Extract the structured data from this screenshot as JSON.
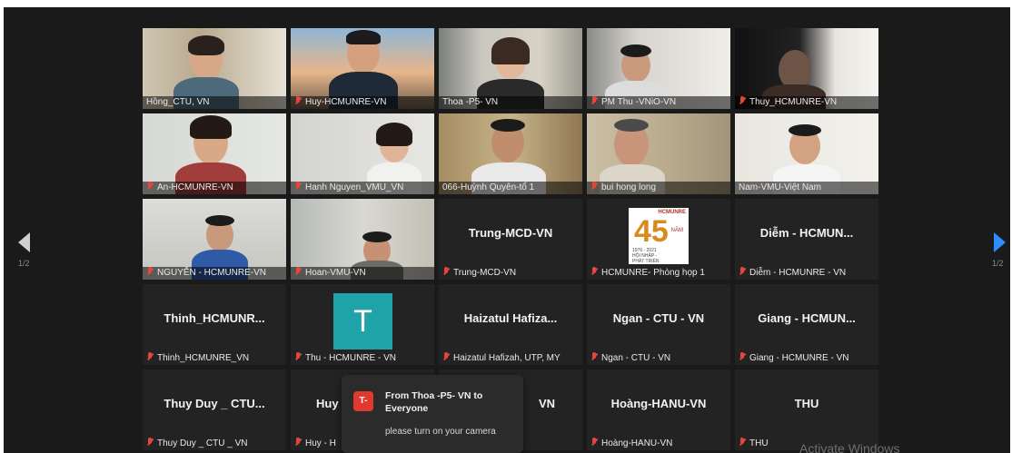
{
  "pager": {
    "left": "1/2",
    "right": "1/2"
  },
  "colors": {
    "accent": "#2d8cff",
    "muted_mic": "#e8453c",
    "active_speaker_border": "#e6e08a",
    "avatar_t": "#20a3a8",
    "chat_avatar": "#e0392e"
  },
  "participants": [
    {
      "name": "Hồng_CTU, VN",
      "muted": false,
      "video": true
    },
    {
      "name": "Huy-HCMUNRE-VN",
      "muted": true,
      "video": true
    },
    {
      "name": "Thoa -P5- VN",
      "muted": false,
      "video": true
    },
    {
      "name": "PM Thu -VNiO-VN",
      "muted": true,
      "video": true
    },
    {
      "name": "Thuy_HCMUNRE-VN",
      "muted": true,
      "video": true
    },
    {
      "name": "An-HCMUNRE-VN",
      "muted": true,
      "video": true
    },
    {
      "name": "Hanh Nguyen_VMU_VN",
      "muted": true,
      "video": true
    },
    {
      "name": "066-Huỳnh Quyên-tổ 1",
      "muted": false,
      "video": true,
      "active": true
    },
    {
      "name": "bui hong long",
      "muted": true,
      "video": true
    },
    {
      "name": "Nam-VMU-Việt Nam",
      "muted": false,
      "video": true
    },
    {
      "name": "NGUYỄN - HCMUNRE-VN",
      "muted": true,
      "video": true
    },
    {
      "name": "Hoan-VMU-VN",
      "muted": true,
      "video": true
    },
    {
      "name": "Trung-MCD-VN",
      "display": "Trung-MCD-VN",
      "muted": true,
      "video": false
    },
    {
      "name": "HCMUNRE- Phòng họp 1",
      "muted": true,
      "video": false,
      "logo": true
    },
    {
      "name": "Diễm - HCMUNRE - VN",
      "display": "Diễm - HCMUN...",
      "muted": true,
      "video": false
    },
    {
      "name": "Thinh_HCMUNRE_VN",
      "display": "Thinh_HCMUNR...",
      "muted": true,
      "video": false
    },
    {
      "name": "Thu - HCMUNRE - VN",
      "avatar_letter": "T",
      "muted": true,
      "video": false
    },
    {
      "name": "Haizatul Hafizah, UTP, MY",
      "display": "Haizatul Hafiza...",
      "muted": true,
      "video": false
    },
    {
      "name": "Ngan - CTU - VN",
      "display": "Ngan - CTU - VN",
      "muted": true,
      "video": false
    },
    {
      "name": "Giang - HCMUNRE - VN",
      "display": "Giang - HCMUN...",
      "muted": true,
      "video": false
    },
    {
      "name": "Thuy Duy _ CTU _ VN",
      "display": "Thuy Duy _ CTU...",
      "muted": true,
      "video": false
    },
    {
      "name": "Huy - H",
      "display": "Huy",
      "muted": true,
      "video": false
    },
    {
      "name": "",
      "display": "VN",
      "muted": false,
      "video": false
    },
    {
      "name": "Hoàng-HANU-VN",
      "display": "Hoàng-HANU-VN",
      "muted": true,
      "video": false
    },
    {
      "name": "THU",
      "display": "THU",
      "muted": true,
      "video": false
    }
  ],
  "logo_tile": {
    "top_text": "HCMUNRE",
    "years": "1976 - 2021",
    "line1": "HỘI NHẬP -",
    "line2": "PHÁT TRIỂN",
    "number": "45",
    "unit": "NĂM"
  },
  "chat_toast": {
    "avatar": "T-",
    "from": "From Thoa -P5- VN to Everyone",
    "message": "please turn on your camera"
  },
  "watermark": "Activate Windows"
}
